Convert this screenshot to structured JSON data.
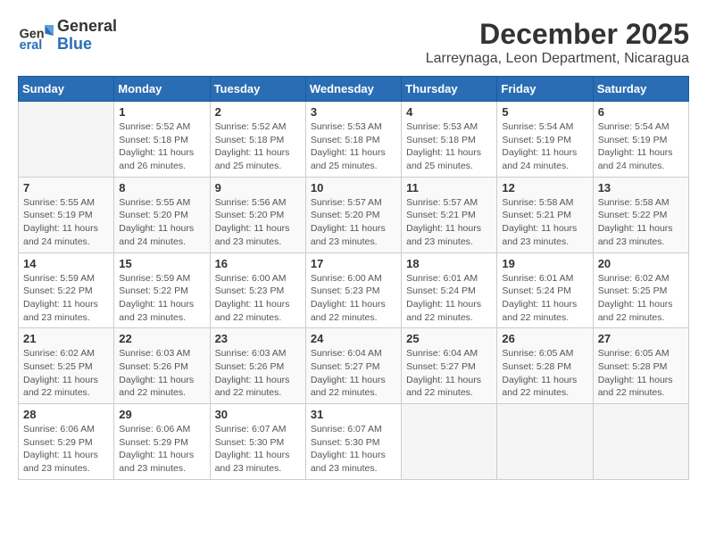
{
  "logo": {
    "general": "General",
    "blue": "Blue"
  },
  "title": "December 2025",
  "subtitle": "Larreynaga, Leon Department, Nicaragua",
  "days_of_week": [
    "Sunday",
    "Monday",
    "Tuesday",
    "Wednesday",
    "Thursday",
    "Friday",
    "Saturday"
  ],
  "weeks": [
    [
      {
        "day": "",
        "info": ""
      },
      {
        "day": "1",
        "info": "Sunrise: 5:52 AM\nSunset: 5:18 PM\nDaylight: 11 hours\nand 26 minutes."
      },
      {
        "day": "2",
        "info": "Sunrise: 5:52 AM\nSunset: 5:18 PM\nDaylight: 11 hours\nand 25 minutes."
      },
      {
        "day": "3",
        "info": "Sunrise: 5:53 AM\nSunset: 5:18 PM\nDaylight: 11 hours\nand 25 minutes."
      },
      {
        "day": "4",
        "info": "Sunrise: 5:53 AM\nSunset: 5:18 PM\nDaylight: 11 hours\nand 25 minutes."
      },
      {
        "day": "5",
        "info": "Sunrise: 5:54 AM\nSunset: 5:19 PM\nDaylight: 11 hours\nand 24 minutes."
      },
      {
        "day": "6",
        "info": "Sunrise: 5:54 AM\nSunset: 5:19 PM\nDaylight: 11 hours\nand 24 minutes."
      }
    ],
    [
      {
        "day": "7",
        "info": "Sunrise: 5:55 AM\nSunset: 5:19 PM\nDaylight: 11 hours\nand 24 minutes."
      },
      {
        "day": "8",
        "info": "Sunrise: 5:55 AM\nSunset: 5:20 PM\nDaylight: 11 hours\nand 24 minutes."
      },
      {
        "day": "9",
        "info": "Sunrise: 5:56 AM\nSunset: 5:20 PM\nDaylight: 11 hours\nand 23 minutes."
      },
      {
        "day": "10",
        "info": "Sunrise: 5:57 AM\nSunset: 5:20 PM\nDaylight: 11 hours\nand 23 minutes."
      },
      {
        "day": "11",
        "info": "Sunrise: 5:57 AM\nSunset: 5:21 PM\nDaylight: 11 hours\nand 23 minutes."
      },
      {
        "day": "12",
        "info": "Sunrise: 5:58 AM\nSunset: 5:21 PM\nDaylight: 11 hours\nand 23 minutes."
      },
      {
        "day": "13",
        "info": "Sunrise: 5:58 AM\nSunset: 5:22 PM\nDaylight: 11 hours\nand 23 minutes."
      }
    ],
    [
      {
        "day": "14",
        "info": "Sunrise: 5:59 AM\nSunset: 5:22 PM\nDaylight: 11 hours\nand 23 minutes."
      },
      {
        "day": "15",
        "info": "Sunrise: 5:59 AM\nSunset: 5:22 PM\nDaylight: 11 hours\nand 23 minutes."
      },
      {
        "day": "16",
        "info": "Sunrise: 6:00 AM\nSunset: 5:23 PM\nDaylight: 11 hours\nand 22 minutes."
      },
      {
        "day": "17",
        "info": "Sunrise: 6:00 AM\nSunset: 5:23 PM\nDaylight: 11 hours\nand 22 minutes."
      },
      {
        "day": "18",
        "info": "Sunrise: 6:01 AM\nSunset: 5:24 PM\nDaylight: 11 hours\nand 22 minutes."
      },
      {
        "day": "19",
        "info": "Sunrise: 6:01 AM\nSunset: 5:24 PM\nDaylight: 11 hours\nand 22 minutes."
      },
      {
        "day": "20",
        "info": "Sunrise: 6:02 AM\nSunset: 5:25 PM\nDaylight: 11 hours\nand 22 minutes."
      }
    ],
    [
      {
        "day": "21",
        "info": "Sunrise: 6:02 AM\nSunset: 5:25 PM\nDaylight: 11 hours\nand 22 minutes."
      },
      {
        "day": "22",
        "info": "Sunrise: 6:03 AM\nSunset: 5:26 PM\nDaylight: 11 hours\nand 22 minutes."
      },
      {
        "day": "23",
        "info": "Sunrise: 6:03 AM\nSunset: 5:26 PM\nDaylight: 11 hours\nand 22 minutes."
      },
      {
        "day": "24",
        "info": "Sunrise: 6:04 AM\nSunset: 5:27 PM\nDaylight: 11 hours\nand 22 minutes."
      },
      {
        "day": "25",
        "info": "Sunrise: 6:04 AM\nSunset: 5:27 PM\nDaylight: 11 hours\nand 22 minutes."
      },
      {
        "day": "26",
        "info": "Sunrise: 6:05 AM\nSunset: 5:28 PM\nDaylight: 11 hours\nand 22 minutes."
      },
      {
        "day": "27",
        "info": "Sunrise: 6:05 AM\nSunset: 5:28 PM\nDaylight: 11 hours\nand 22 minutes."
      }
    ],
    [
      {
        "day": "28",
        "info": "Sunrise: 6:06 AM\nSunset: 5:29 PM\nDaylight: 11 hours\nand 23 minutes."
      },
      {
        "day": "29",
        "info": "Sunrise: 6:06 AM\nSunset: 5:29 PM\nDaylight: 11 hours\nand 23 minutes."
      },
      {
        "day": "30",
        "info": "Sunrise: 6:07 AM\nSunset: 5:30 PM\nDaylight: 11 hours\nand 23 minutes."
      },
      {
        "day": "31",
        "info": "Sunrise: 6:07 AM\nSunset: 5:30 PM\nDaylight: 11 hours\nand 23 minutes."
      },
      {
        "day": "",
        "info": ""
      },
      {
        "day": "",
        "info": ""
      },
      {
        "day": "",
        "info": ""
      }
    ]
  ]
}
